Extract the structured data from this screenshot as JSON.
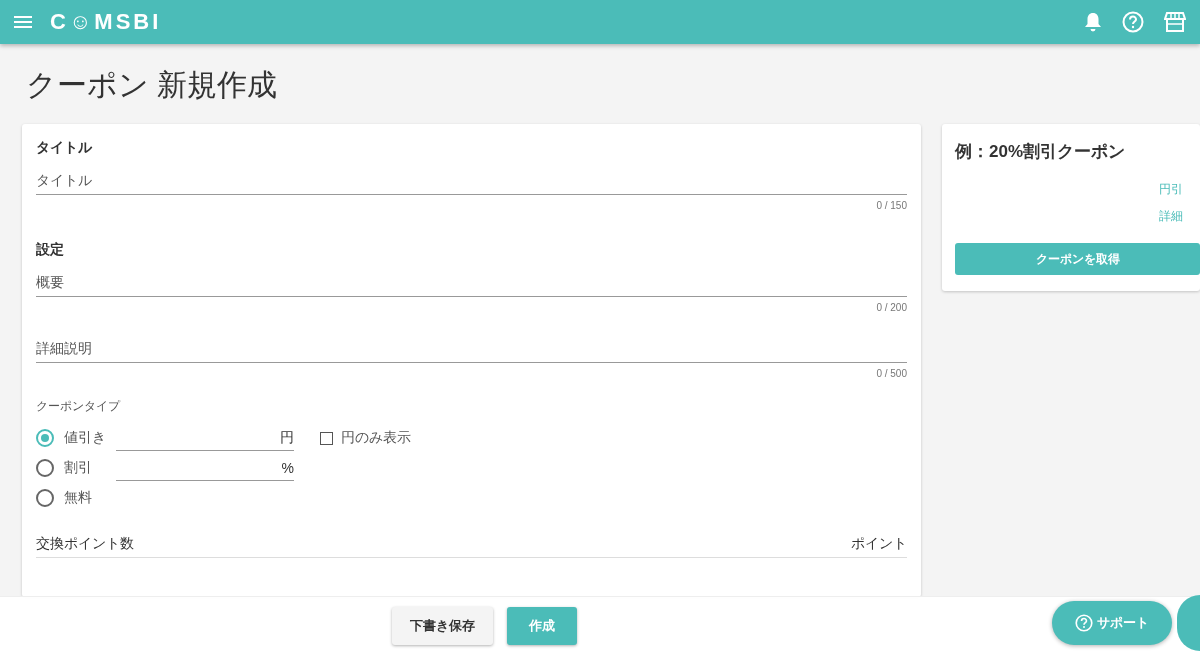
{
  "header": {
    "logo": "C☺MSBI"
  },
  "page_title": "クーポン 新規作成",
  "form": {
    "title_section": {
      "heading": "タイトル",
      "field": {
        "placeholder": "タイトル",
        "counter": "0 / 150"
      }
    },
    "settings_section": {
      "heading": "設定",
      "fields": [
        {
          "placeholder": "概要",
          "counter": "0 / 200"
        },
        {
          "placeholder": "詳細説明",
          "counter": "0 / 500"
        }
      ]
    },
    "coupon_type": {
      "label": "クーポンタイプ",
      "options": [
        {
          "label": "値引き",
          "selected": true,
          "unit": "円",
          "checkbox": {
            "label": "円のみ表示",
            "checked": false
          }
        },
        {
          "label": "割引",
          "selected": false,
          "unit": "%"
        },
        {
          "label": "無料",
          "selected": false
        }
      ]
    },
    "points": {
      "label": "交換ポイント数",
      "unit": "ポイント"
    }
  },
  "preview": {
    "title": "例：20%割引クーポン",
    "lines": [
      "円引",
      "詳細"
    ],
    "button": "クーポンを取得"
  },
  "footer": {
    "buttons": [
      {
        "label": "下書き保存",
        "kind": "secondary"
      },
      {
        "label": "作成",
        "kind": "primary"
      }
    ],
    "support": "サポート"
  }
}
